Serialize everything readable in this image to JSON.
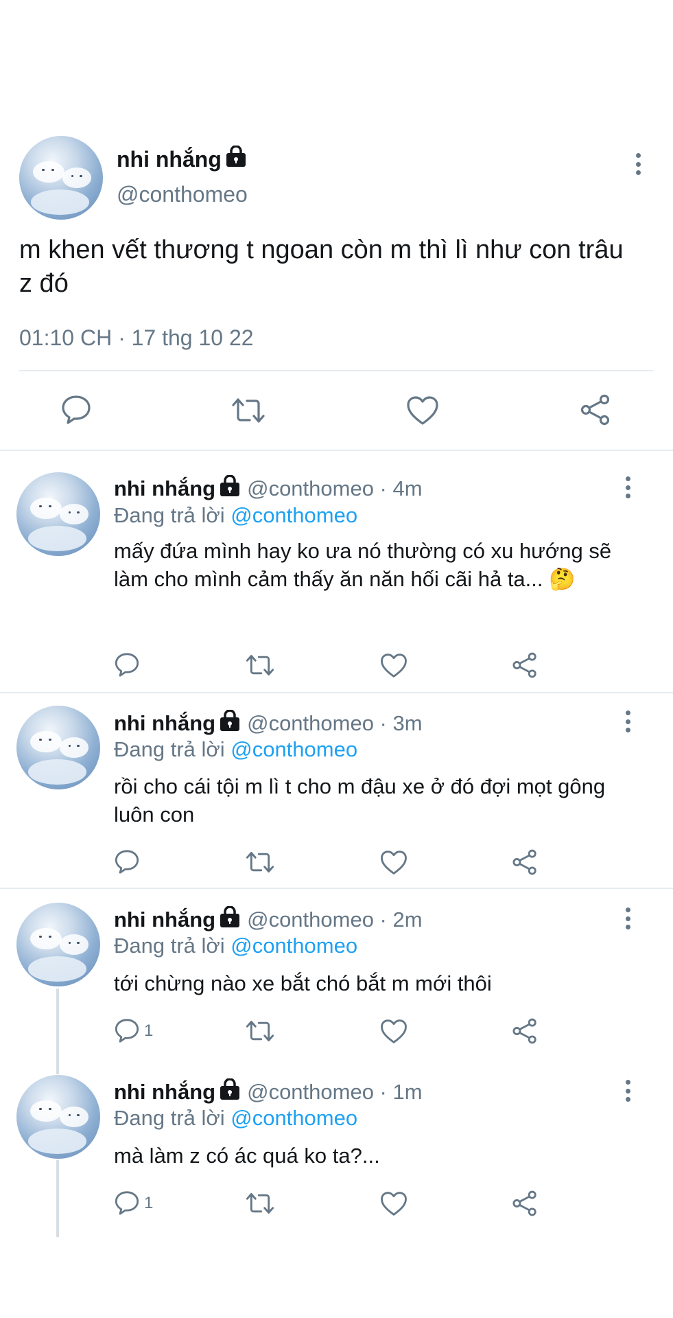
{
  "main_tweet": {
    "name": "nhi nhắng",
    "handle": "@conthomeo",
    "text": "m khen vết thương t ngoan còn m thì lì như con trâu z đó",
    "timestamp": "01:10 CH · 17 thg 10 22"
  },
  "replies": [
    {
      "name": "nhi nhắng",
      "handle": "@conthomeo · 4m",
      "replying_prefix": "Đang trả lời ",
      "replying_to": "@conthomeo",
      "text": " mấy đứa mình hay ko ưa nó thường có xu hướng sẽ làm cho mình cảm thấy ăn năn hối cãi hả ta... 🤔",
      "reply_count": ""
    },
    {
      "name": "nhi nhắng",
      "handle": "@conthomeo · 3m",
      "replying_prefix": "Đang trả lời ",
      "replying_to": "@conthomeo",
      "text": "rồi cho cái tội m lì t cho m đậu xe ở đó đợi mọt gông luôn con",
      "reply_count": ""
    },
    {
      "name": "nhi nhắng",
      "handle": "@conthomeo · 2m",
      "replying_prefix": "Đang trả lời ",
      "replying_to": "@conthomeo",
      "text": "tới chừng nào xe bắt chó bắt m mới thôi",
      "reply_count": "1"
    },
    {
      "name": "nhi nhắng",
      "handle": "@conthomeo · 1m",
      "replying_prefix": "Đang trả lời ",
      "replying_to": "@conthomeo",
      "text": "mà làm z có ác quá ko ta?...",
      "reply_count": "1"
    }
  ],
  "icons": {
    "reply": "speech-bubble-icon",
    "retweet": "retweet-arrows-icon",
    "like": "heart-icon",
    "share": "share-nodes-icon",
    "more": "vertical-dots-icon",
    "lock": "padlock-icon"
  },
  "colors": {
    "text": "#14171a",
    "secondary": "#657786",
    "mention": "#1da1f2",
    "divider": "#e6ecf0"
  }
}
